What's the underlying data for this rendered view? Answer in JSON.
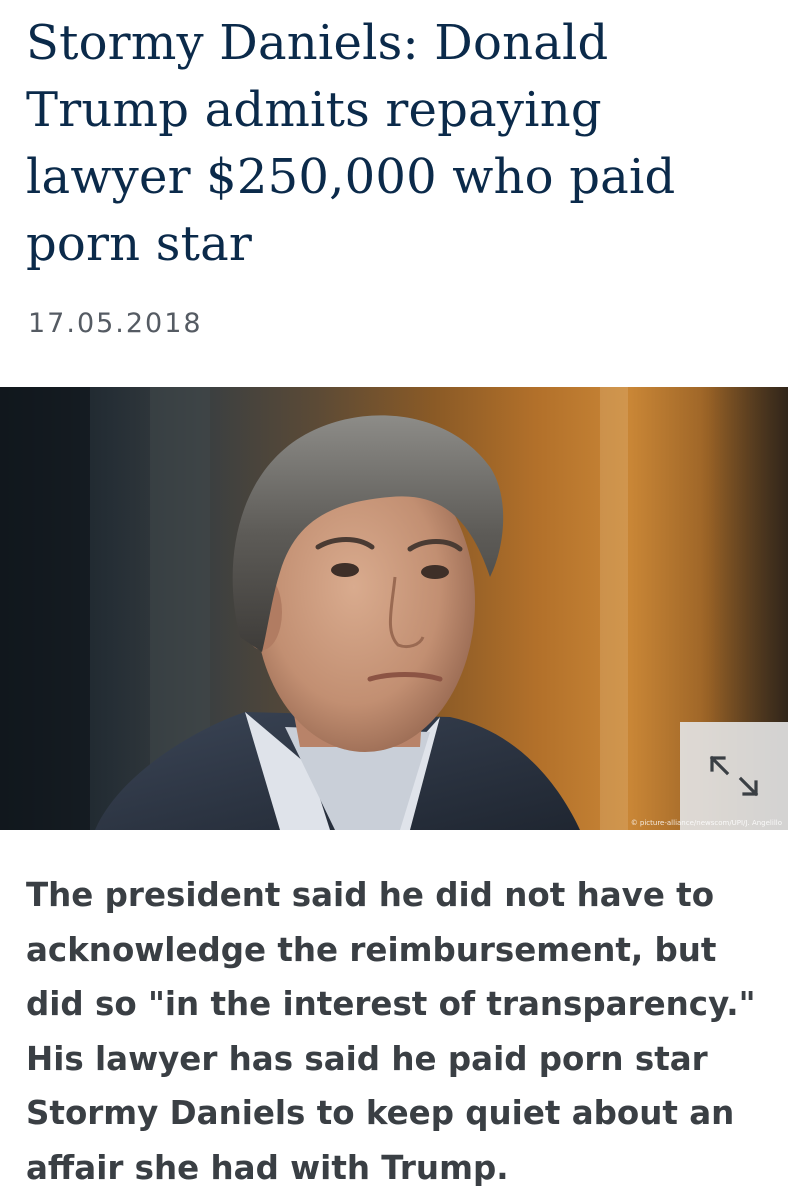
{
  "article": {
    "headline": "Stormy Daniels: Donald Trump admits repaying lawyer $250,000 who paid porn star",
    "date": "17.05.2018",
    "image": {
      "credit": "© picture-alliance/newscom/UPI/J. Angelillo",
      "expand_icon": "expand-arrows-icon"
    },
    "lead": "The president said he did not have to acknowledge the reimbursement, but did so \"in the interest of transparency.\" His lawyer has said he paid porn star Stormy Daniels to keep quiet about an affair she had with Trump."
  },
  "colors": {
    "headline": "#0b2a4a",
    "date": "#555b63",
    "lead": "#3a3f44",
    "expand_button_bg": "#e2e2e2",
    "expand_icon": "#3a3f44"
  }
}
